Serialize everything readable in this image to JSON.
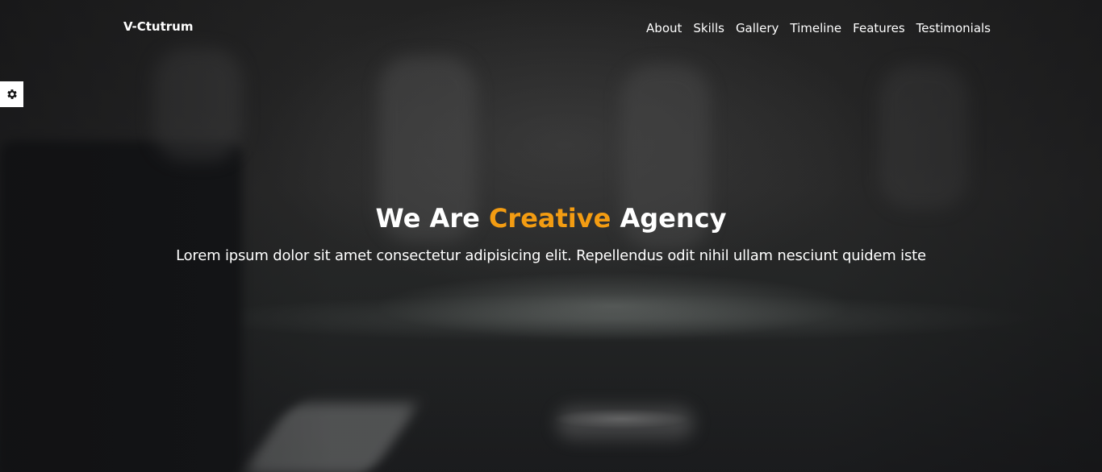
{
  "brand": {
    "name": "V-Ctutrum"
  },
  "nav": {
    "items": [
      {
        "label": "About"
      },
      {
        "label": "Skills"
      },
      {
        "label": "Gallery"
      },
      {
        "label": "Timeline"
      },
      {
        "label": "Features"
      },
      {
        "label": "Testimonials"
      }
    ]
  },
  "settings": {
    "icon": "gear-icon"
  },
  "hero": {
    "headline_prefix": "We Are ",
    "headline_accent": "Creative",
    "headline_suffix": " Agency",
    "subtitle": "Lorem ipsum dolor sit amet consectetur adipisicing elit. Repellendus odit nihil ullam nesciunt quidem iste"
  },
  "colors": {
    "accent": "#f39c12",
    "text": "#ffffff",
    "background": "#1c1d1f"
  }
}
